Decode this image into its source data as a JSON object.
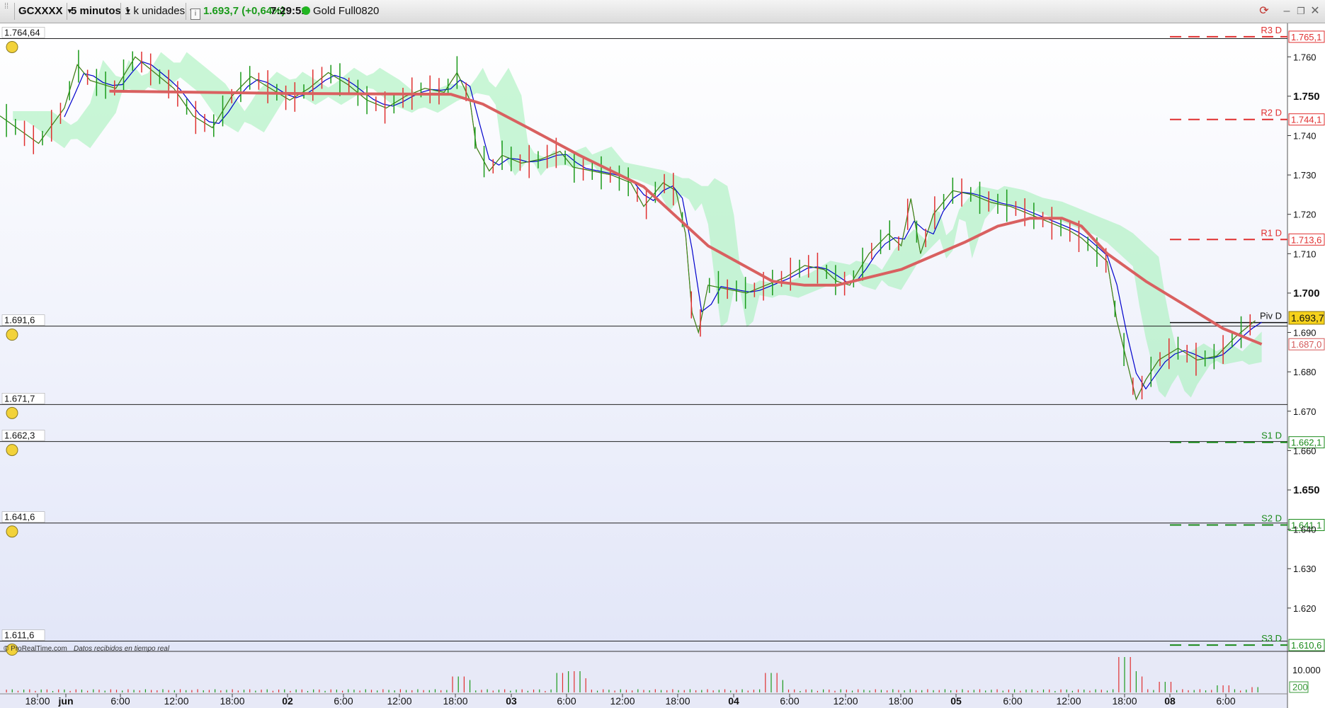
{
  "toolbar": {
    "symbol": "GCXXXX",
    "timeframe": "5 minutos",
    "units": "1 k unidades",
    "price_change": "1.693,7 (+0,64%)",
    "time": "7:29:51",
    "contract": "Gold Full0820"
  },
  "colors": {
    "price": "#1a9a1a",
    "resistance": "#e03030",
    "support": "#1a8a1a",
    "moving_average": "#d96060",
    "tenkan": "#0000cc",
    "kijun": "#e02020",
    "cloud_up": "#9ff0b4",
    "cloud_down": "#9fe8ef",
    "current_price_bg": "#f6d21c"
  },
  "chart_data": {
    "type": "line",
    "ylim": [
      1609.0,
      1768.5
    ],
    "y_ticks": [
      1760,
      1750,
      1740,
      1730,
      1720,
      1710,
      1700,
      1690,
      1680,
      1670,
      1660,
      1650,
      1640,
      1630,
      1620
    ],
    "y_tick_labels": [
      "1.760",
      "1.750",
      "1.740",
      "1.730",
      "1.720",
      "1.710",
      "1.700",
      "1.690",
      "1.680",
      "1.670",
      "1.660",
      "1.650",
      "1.640",
      "1.630",
      "1.620"
    ],
    "major_ticks": [
      1750,
      1700,
      1650
    ],
    "x_labels": [
      "18:00",
      "jun",
      "6:00",
      "12:00",
      "18:00",
      "02",
      "6:00",
      "12:00",
      "18:00",
      "03",
      "6:00",
      "12:00",
      "18:00",
      "04",
      "6:00",
      "12:00",
      "18:00",
      "05",
      "6:00",
      "12:00",
      "18:00",
      "08",
      "6:00"
    ],
    "x_labels_bold": [
      "jun",
      "02",
      "03",
      "04",
      "05",
      "08"
    ],
    "price_series": [
      [
        0,
        1745
      ],
      [
        6,
        1738
      ],
      [
        10,
        1747
      ],
      [
        12,
        1758
      ],
      [
        14,
        1754
      ],
      [
        18,
        1752
      ],
      [
        21,
        1760
      ],
      [
        24,
        1756
      ],
      [
        27,
        1752
      ],
      [
        30,
        1745
      ],
      [
        33,
        1742
      ],
      [
        36,
        1750
      ],
      [
        39,
        1755
      ],
      [
        42,
        1752
      ],
      [
        45,
        1749
      ],
      [
        48,
        1752
      ],
      [
        51,
        1756
      ],
      [
        54,
        1753
      ],
      [
        57,
        1749
      ],
      [
        60,
        1747
      ],
      [
        63,
        1750
      ],
      [
        66,
        1752
      ],
      [
        69,
        1751
      ],
      [
        71,
        1756
      ],
      [
        73,
        1749
      ],
      [
        74,
        1737
      ],
      [
        76,
        1731
      ],
      [
        78,
        1735
      ],
      [
        81,
        1733
      ],
      [
        84,
        1734
      ],
      [
        87,
        1736
      ],
      [
        89,
        1732
      ],
      [
        92,
        1731
      ],
      [
        95,
        1730
      ],
      [
        98,
        1728
      ],
      [
        100,
        1722
      ],
      [
        103,
        1728
      ],
      [
        105,
        1726
      ],
      [
        106.5,
        1715
      ],
      [
        107.5,
        1695
      ],
      [
        108.5,
        1690
      ],
      [
        110,
        1702
      ],
      [
        113,
        1701
      ],
      [
        116,
        1700
      ],
      [
        119,
        1702
      ],
      [
        122,
        1704
      ],
      [
        125,
        1707
      ],
      [
        128,
        1706
      ],
      [
        130,
        1703
      ],
      [
        132,
        1702
      ],
      [
        135,
        1710
      ],
      [
        138,
        1715
      ],
      [
        140,
        1712
      ],
      [
        141.5,
        1724
      ],
      [
        143,
        1710
      ],
      [
        145,
        1720
      ],
      [
        148,
        1726
      ],
      [
        151,
        1725
      ],
      [
        154,
        1723
      ],
      [
        157,
        1722
      ],
      [
        160,
        1720
      ],
      [
        163,
        1718
      ],
      [
        166,
        1716
      ],
      [
        168,
        1714
      ],
      [
        170,
        1711
      ],
      [
        172,
        1708
      ],
      [
        173.5,
        1693
      ],
      [
        175,
        1683
      ],
      [
        176.5,
        1673
      ],
      [
        178,
        1678
      ],
      [
        180,
        1683
      ],
      [
        183,
        1686
      ],
      [
        186,
        1683
      ],
      [
        189,
        1684
      ],
      [
        192,
        1689
      ],
      [
        195,
        1693
      ]
    ],
    "moving_average": [
      [
        17,
        1751.3
      ],
      [
        30,
        1751
      ],
      [
        45,
        1750.7
      ],
      [
        70,
        1750.5
      ],
      [
        75,
        1748
      ],
      [
        82,
        1742
      ],
      [
        90,
        1735
      ],
      [
        95,
        1731
      ],
      [
        100,
        1727
      ],
      [
        110,
        1712
      ],
      [
        120,
        1703
      ],
      [
        125,
        1702
      ],
      [
        130,
        1702
      ],
      [
        140,
        1706
      ],
      [
        150,
        1713
      ],
      [
        155,
        1717
      ],
      [
        160,
        1719
      ],
      [
        165,
        1719
      ],
      [
        168,
        1717
      ],
      [
        172,
        1710
      ],
      [
        178,
        1703
      ],
      [
        184,
        1697
      ],
      [
        190,
        1691
      ],
      [
        196,
        1687
      ]
    ],
    "horizontal_lines": [
      {
        "label": "1.764,64",
        "value": 1764.64
      },
      {
        "label": "1.691,6",
        "value": 1691.6
      },
      {
        "label": "1.671,7",
        "value": 1671.7
      },
      {
        "label": "1.662,3",
        "value": 1662.3
      },
      {
        "label": "1.641,6",
        "value": 1641.6
      },
      {
        "label": "1.611,6",
        "value": 1611.6
      }
    ],
    "pivot_levels": [
      {
        "name": "R3 D",
        "value": 1765.1,
        "label": "1.765,1",
        "kind": "resistance"
      },
      {
        "name": "R2 D",
        "value": 1744.1,
        "label": "1.744,1",
        "kind": "resistance"
      },
      {
        "name": "R1 D",
        "value": 1713.6,
        "label": "1.713,6",
        "kind": "resistance"
      },
      {
        "name": "Piv D",
        "value": 1692.5,
        "label": "",
        "kind": "pivot"
      },
      {
        "name": "S1 D",
        "value": 1662.1,
        "label": "1.662,1",
        "kind": "support"
      },
      {
        "name": "S2 D",
        "value": 1641.1,
        "label": "1.641,1",
        "kind": "support"
      },
      {
        "name": "S3 D",
        "value": 1610.6,
        "label": "1.610,6",
        "kind": "support"
      }
    ],
    "current_price": {
      "value": 1693.7,
      "label": "1.693,7"
    },
    "marker_1687": {
      "value": 1687.0,
      "label": "1.687,0"
    },
    "volume_axis": [
      "10.000",
      "200"
    ],
    "volume_series": [
      [
        71,
        0.45
      ],
      [
        72,
        0.35
      ],
      [
        87,
        0.55
      ],
      [
        89,
        0.6
      ],
      [
        90,
        0.4
      ],
      [
        120,
        0.55
      ],
      [
        121,
        0.35
      ],
      [
        175,
        1.0
      ],
      [
        176,
        0.6
      ],
      [
        177,
        0.45
      ],
      [
        181,
        0.3
      ],
      [
        190,
        0.2
      ],
      [
        195,
        0.15
      ]
    ],
    "footer_brand": "© ProRealTime.com",
    "footer_text": "Datos recibidos en tiempo real"
  }
}
